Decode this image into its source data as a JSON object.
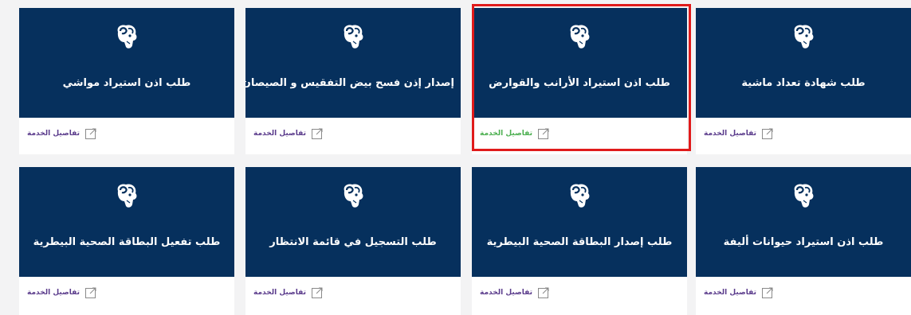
{
  "colors": {
    "card_header": "#06305d",
    "link": "#5b3c8c",
    "link_active": "#4caf50",
    "highlight_border": "#e01b1b",
    "page_bg": "#f3f3f4"
  },
  "cards": [
    {
      "title": "طلب شهادة تعداد ماشية",
      "details_label": "تفاصيل الخدمة",
      "icon": "ram-head-logo-icon",
      "link_icon": "external-link-icon"
    },
    {
      "title": "طلب اذن استيراد الأرانب والقوارض",
      "details_label": "تفاصيل الخدمة",
      "icon": "ram-head-logo-icon",
      "link_icon": "external-link-icon",
      "selected": true
    },
    {
      "title": "إصدار إذن فسح بيض التفقيس و الصيصان",
      "details_label": "تفاصيل الخدمة",
      "icon": "ram-head-logo-icon",
      "link_icon": "external-link-icon"
    },
    {
      "title": "طلب اذن استيراد مواشي",
      "details_label": "تفاصيل الخدمة",
      "icon": "ram-head-logo-icon",
      "link_icon": "external-link-icon"
    },
    {
      "title": "طلب اذن استيراد حيوانات أليفة",
      "details_label": "تفاصيل الخدمة",
      "icon": "ram-head-logo-icon",
      "link_icon": "external-link-icon"
    },
    {
      "title": "طلب إصدار البطاقة الصحية البيطرية",
      "details_label": "تفاصيل الخدمة",
      "icon": "ram-head-logo-icon",
      "link_icon": "external-link-icon"
    },
    {
      "title": "طلب التسجيل في قائمة الانتظار",
      "details_label": "تفاصيل الخدمة",
      "icon": "ram-head-logo-icon",
      "link_icon": "external-link-icon"
    },
    {
      "title": "طلب تفعيل البطاقة الصحية البيطرية",
      "details_label": "تفاصيل الخدمة",
      "icon": "ram-head-logo-icon",
      "link_icon": "external-link-icon"
    }
  ]
}
